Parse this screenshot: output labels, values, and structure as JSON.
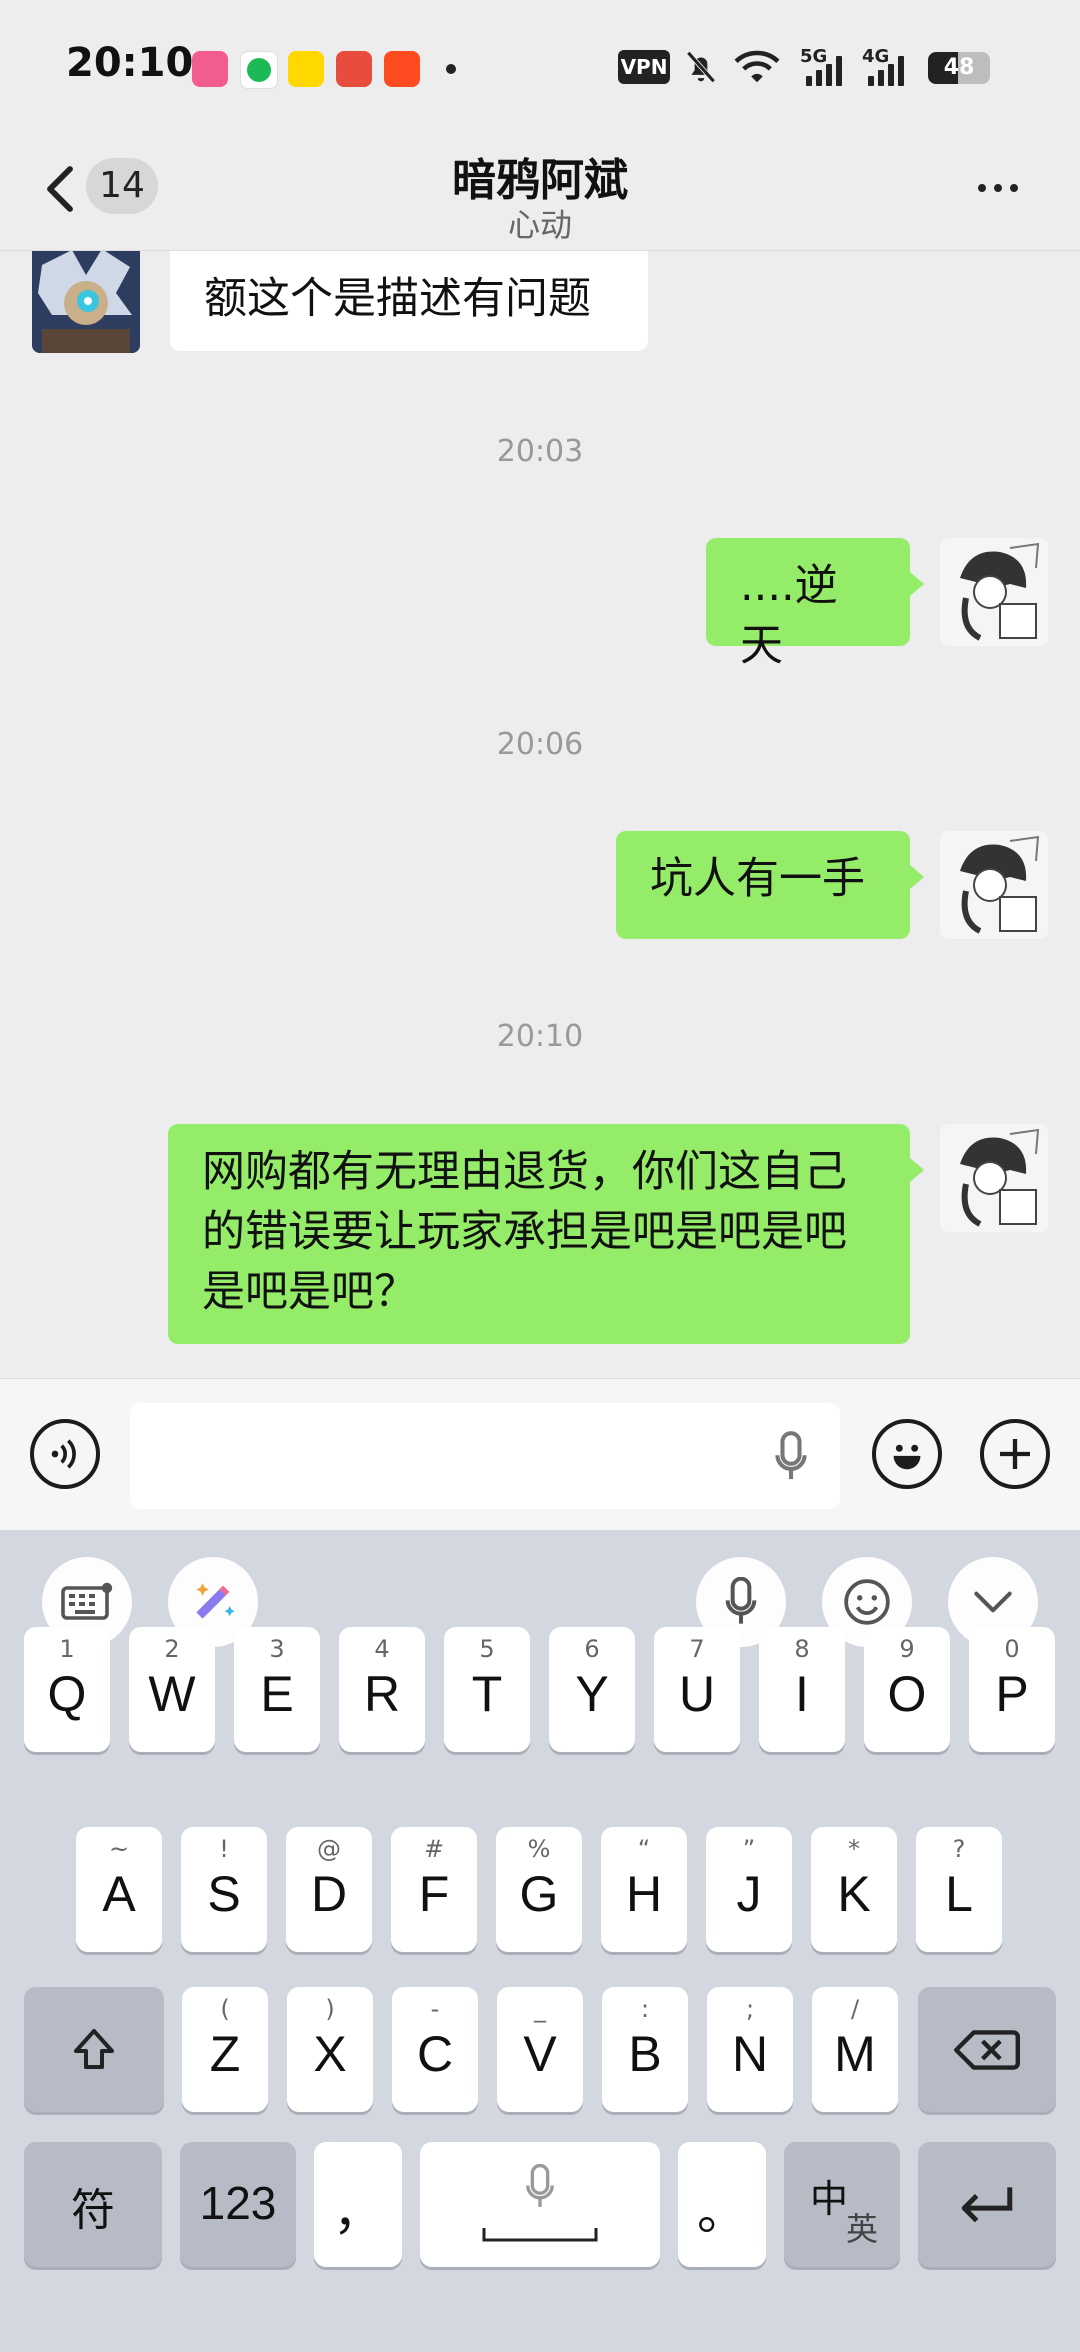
{
  "status_bar": {
    "time": "20:10",
    "vpn_label": "VPN",
    "signal1_label": "5G",
    "signal2_label": "4G",
    "battery_level": "48",
    "app_icons": [
      "bilibili-icon",
      "spotify-icon",
      "game-app-icon",
      "red-app-icon",
      "taobao-icon"
    ]
  },
  "header": {
    "back_badge": "14",
    "title": "暗鸦阿斌",
    "subtitle": "心动"
  },
  "messages": [
    {
      "side": "in",
      "text": "额这个是描述有问题"
    },
    {
      "timestamp": "20:03"
    },
    {
      "side": "out",
      "text": "....逆天"
    },
    {
      "timestamp": "20:06"
    },
    {
      "side": "out",
      "text": "坑人有一手"
    },
    {
      "timestamp": "20:10"
    },
    {
      "side": "out",
      "text": "网购都有无理由退货，你们这自己的错误要让玩家承担是吧是吧是吧是吧是吧？"
    }
  ],
  "keyboard": {
    "row1": [
      [
        "1",
        "Q"
      ],
      [
        "2",
        "W"
      ],
      [
        "3",
        "E"
      ],
      [
        "4",
        "R"
      ],
      [
        "5",
        "T"
      ],
      [
        "6",
        "Y"
      ],
      [
        "7",
        "U"
      ],
      [
        "8",
        "I"
      ],
      [
        "9",
        "O"
      ],
      [
        "0",
        "P"
      ]
    ],
    "row2": [
      [
        "~",
        "A"
      ],
      [
        "!",
        "S"
      ],
      [
        "@",
        "D"
      ],
      [
        "#",
        "F"
      ],
      [
        "%",
        "G"
      ],
      [
        "“",
        "H"
      ],
      [
        "”",
        "J"
      ],
      [
        "*",
        "K"
      ],
      [
        "?",
        "L"
      ]
    ],
    "row3": [
      [
        "(",
        "Z"
      ],
      [
        ")",
        "X"
      ],
      [
        "-",
        "C"
      ],
      [
        "_",
        "V"
      ],
      [
        ":",
        "B"
      ],
      [
        ";",
        "N"
      ],
      [
        "/",
        "M"
      ]
    ],
    "fu_label": "符",
    "num_label": "123",
    "comma_label": "，",
    "period_label": "。",
    "lang_zh": "中",
    "lang_en": "英"
  },
  "colors": {
    "outgoing_bubble": "#95ec69",
    "incoming_bubble": "#ffffff",
    "chat_bg": "#ededed",
    "keyboard_bg": "#d3d7e0"
  }
}
